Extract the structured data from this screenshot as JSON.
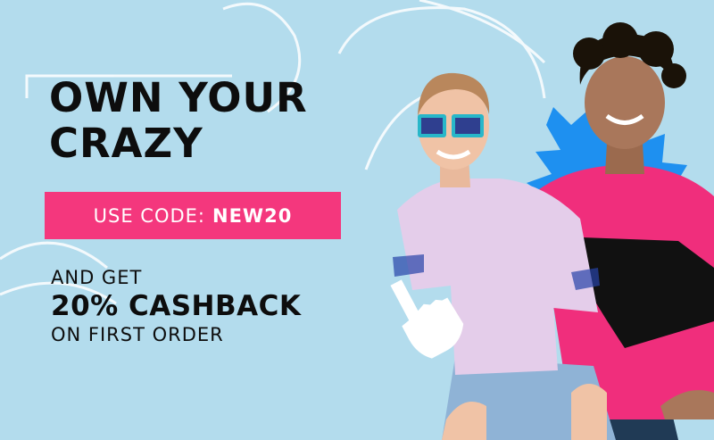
{
  "banner": {
    "headline_line1": "OWN YOUR",
    "headline_line2": "CRAZY",
    "code_label": "USE CODE:",
    "code_value": "NEW20",
    "offer_line1": "AND GET",
    "offer_line2": "20% CASHBACK",
    "offer_line3": "ON FIRST ORDER"
  },
  "colors": {
    "background": "#b3dced",
    "accent_pink": "#f4377d",
    "text": "#0d0d0d",
    "starburst": "#1e90f0"
  },
  "icons": [
    "pointing-hand-icon",
    "starburst-shape"
  ]
}
